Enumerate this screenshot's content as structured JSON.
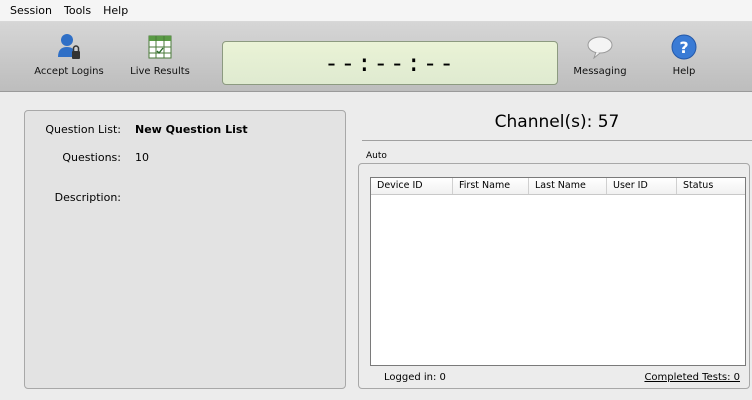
{
  "menu": [
    "Session",
    "Tools",
    "Help"
  ],
  "toolbar": {
    "accept_logins": "Accept Logins",
    "live_results": "Live Results",
    "messaging": "Messaging",
    "help": "Help",
    "timer": "--:--:--"
  },
  "left_panel": {
    "question_list_label": "Question List:",
    "question_list_value": "New Question List",
    "questions_label": "Questions:",
    "questions_value": "10",
    "description_label": "Description:"
  },
  "right_panel": {
    "channel_title": "Channel(s): 57",
    "mode_label": "Auto",
    "columns": [
      "Device ID",
      "First Name",
      "Last Name",
      "User ID",
      "Status"
    ],
    "logged_in": "Logged in:  0",
    "completed_tests": "Completed Tests:  0"
  },
  "colors": {
    "toolbar_bg": "#c8c8c8",
    "timer_bg": "#e4eed4",
    "accent_help": "#3a7bd5"
  }
}
